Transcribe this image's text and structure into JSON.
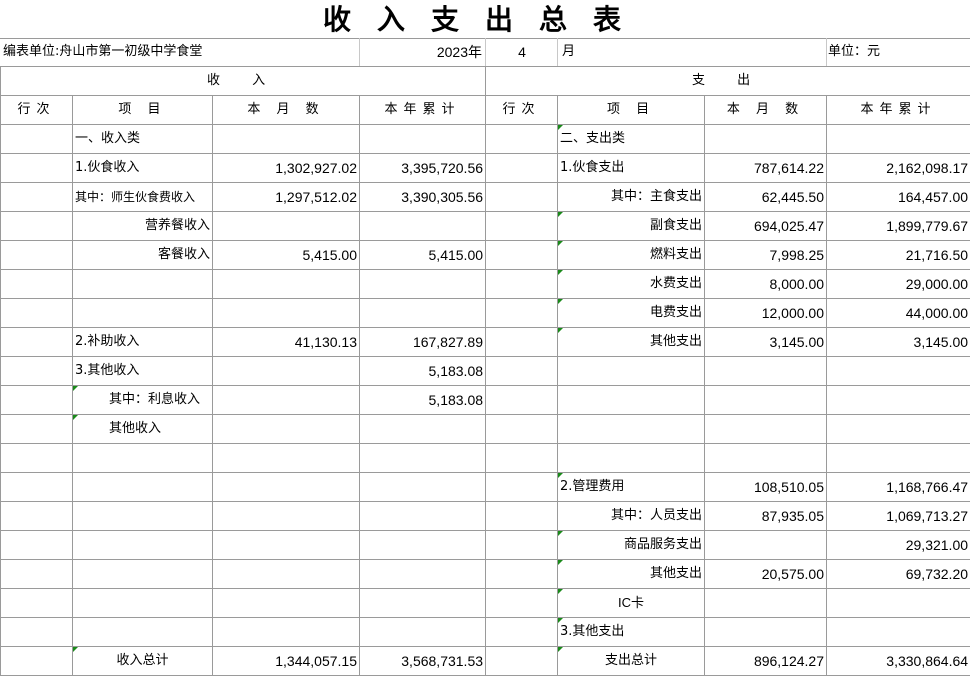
{
  "title": "收入支出总表",
  "header": {
    "unit_label": "编表单位:舟山市第一初级中学食堂",
    "year": "2023年",
    "month_num": "4",
    "month_label": "月",
    "currency": "单位：元"
  },
  "sections": {
    "income": "收    入",
    "expense": "支      出"
  },
  "columns": {
    "row_no": "行次",
    "item": "项    目",
    "month": "本  月  数",
    "ytd": "本年累计"
  },
  "rows": [
    {
      "li": "一、收入类",
      "lm": "",
      "ly": "",
      "ri": "二、支出类",
      "rm": "",
      "ry": ""
    },
    {
      "li": "1.伙食收入",
      "lm": "1,302,927.02",
      "ly": "3,395,720.56",
      "ri": "1.伙食支出",
      "rm": "787,614.22",
      "ry": "2,162,098.17"
    },
    {
      "li": "其中：师生伙食费收入",
      "lm": "1,297,512.02",
      "ly": "3,390,305.56",
      "ri": "其中：主食支出",
      "rm": "62,445.50",
      "ry": "164,457.00"
    },
    {
      "li": "营养餐收入",
      "lm": "",
      "ly": "",
      "ri": "副食支出",
      "rm": "694,025.47",
      "ry": "1,899,779.67"
    },
    {
      "li": "客餐收入",
      "lm": "5,415.00",
      "ly": "5,415.00",
      "ri": "燃料支出",
      "rm": "7,998.25",
      "ry": "21,716.50"
    },
    {
      "li": "",
      "lm": "",
      "ly": "",
      "ri": "水费支出",
      "rm": "8,000.00",
      "ry": "29,000.00"
    },
    {
      "li": "",
      "lm": "",
      "ly": "",
      "ri": "电费支出",
      "rm": "12,000.00",
      "ry": "44,000.00"
    },
    {
      "li": "2.补助收入",
      "lm": "41,130.13",
      "ly": "167,827.89",
      "ri": "其他支出",
      "rm": "3,145.00",
      "ry": "3,145.00"
    },
    {
      "li": "3.其他收入",
      "lm": "",
      "ly": "5,183.08",
      "ri": "",
      "rm": "",
      "ry": ""
    },
    {
      "li": "其中：利息收入",
      "lm": "",
      "ly": "5,183.08",
      "ri": "",
      "rm": "",
      "ry": ""
    },
    {
      "li": "其他收入",
      "lm": "",
      "ly": "",
      "ri": "",
      "rm": "",
      "ry": ""
    },
    {
      "li": "",
      "lm": "",
      "ly": "",
      "ri": "",
      "rm": "",
      "ry": ""
    },
    {
      "li": "",
      "lm": "",
      "ly": "",
      "ri": "2.管理费用",
      "rm": "108,510.05",
      "ry": "1,168,766.47"
    },
    {
      "li": "",
      "lm": "",
      "ly": "",
      "ri": "其中：人员支出",
      "rm": "87,935.05",
      "ry": "1,069,713.27"
    },
    {
      "li": "",
      "lm": "",
      "ly": "",
      "ri": "商品服务支出",
      "rm": "",
      "ry": "29,321.00"
    },
    {
      "li": "",
      "lm": "",
      "ly": "",
      "ri": "其他支出",
      "rm": "20,575.00",
      "ry": "69,732.20"
    },
    {
      "li": "",
      "lm": "",
      "ly": "",
      "ri": "IC卡",
      "rm": "",
      "ry": ""
    },
    {
      "li": "",
      "lm": "",
      "ly": "",
      "ri": "3.其他支出",
      "rm": "",
      "ry": ""
    },
    {
      "li": "收入总计",
      "lm": "1,344,057.15",
      "ly": "3,568,731.53",
      "ri": "支出总计",
      "rm": "896,124.27",
      "ry": "3,330,864.64"
    }
  ],
  "colors": {
    "grid": "#9a9a9a",
    "comment_marker": "#1a8a1a"
  }
}
